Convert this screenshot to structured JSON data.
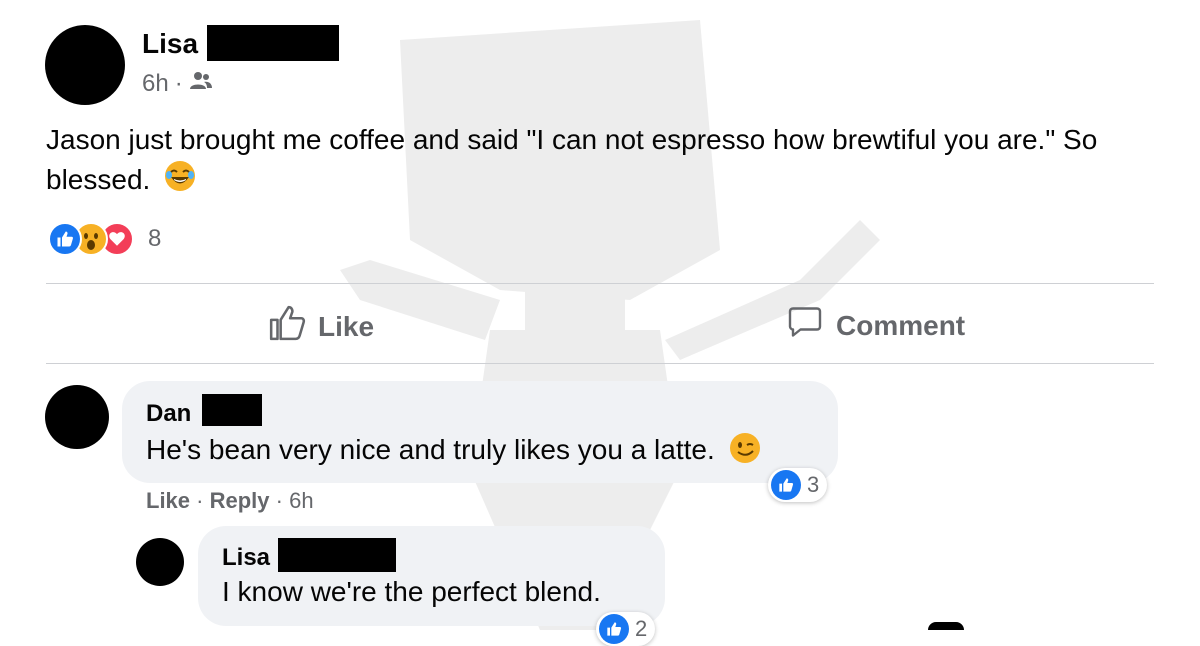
{
  "post": {
    "author": "Lisa",
    "time": "6h",
    "separator": "·",
    "text": "Jason just brought me coffee and said \"I can not espresso how brewtiful you are.\" So blessed.",
    "reaction_count": "8",
    "actions": {
      "like": "Like",
      "comment": "Comment"
    }
  },
  "comments": [
    {
      "author": "Dan",
      "text": "He's bean very nice and truly likes you a latte.",
      "like_label": "Like",
      "reply_label": "Reply",
      "time": "6h",
      "reaction_count": "3"
    },
    {
      "author": "Lisa",
      "text": "I know we're the perfect blend.",
      "reaction_count": "2"
    }
  ],
  "icons": {
    "friends": "friends-audience-icon",
    "like": "thumbs-up-icon",
    "comment": "speech-bubble-icon"
  },
  "colors": {
    "like_blue": "#1877f2",
    "love_red": "#f33e58",
    "wow_yellow": "#f7b125",
    "secondary_text": "#65676b"
  }
}
